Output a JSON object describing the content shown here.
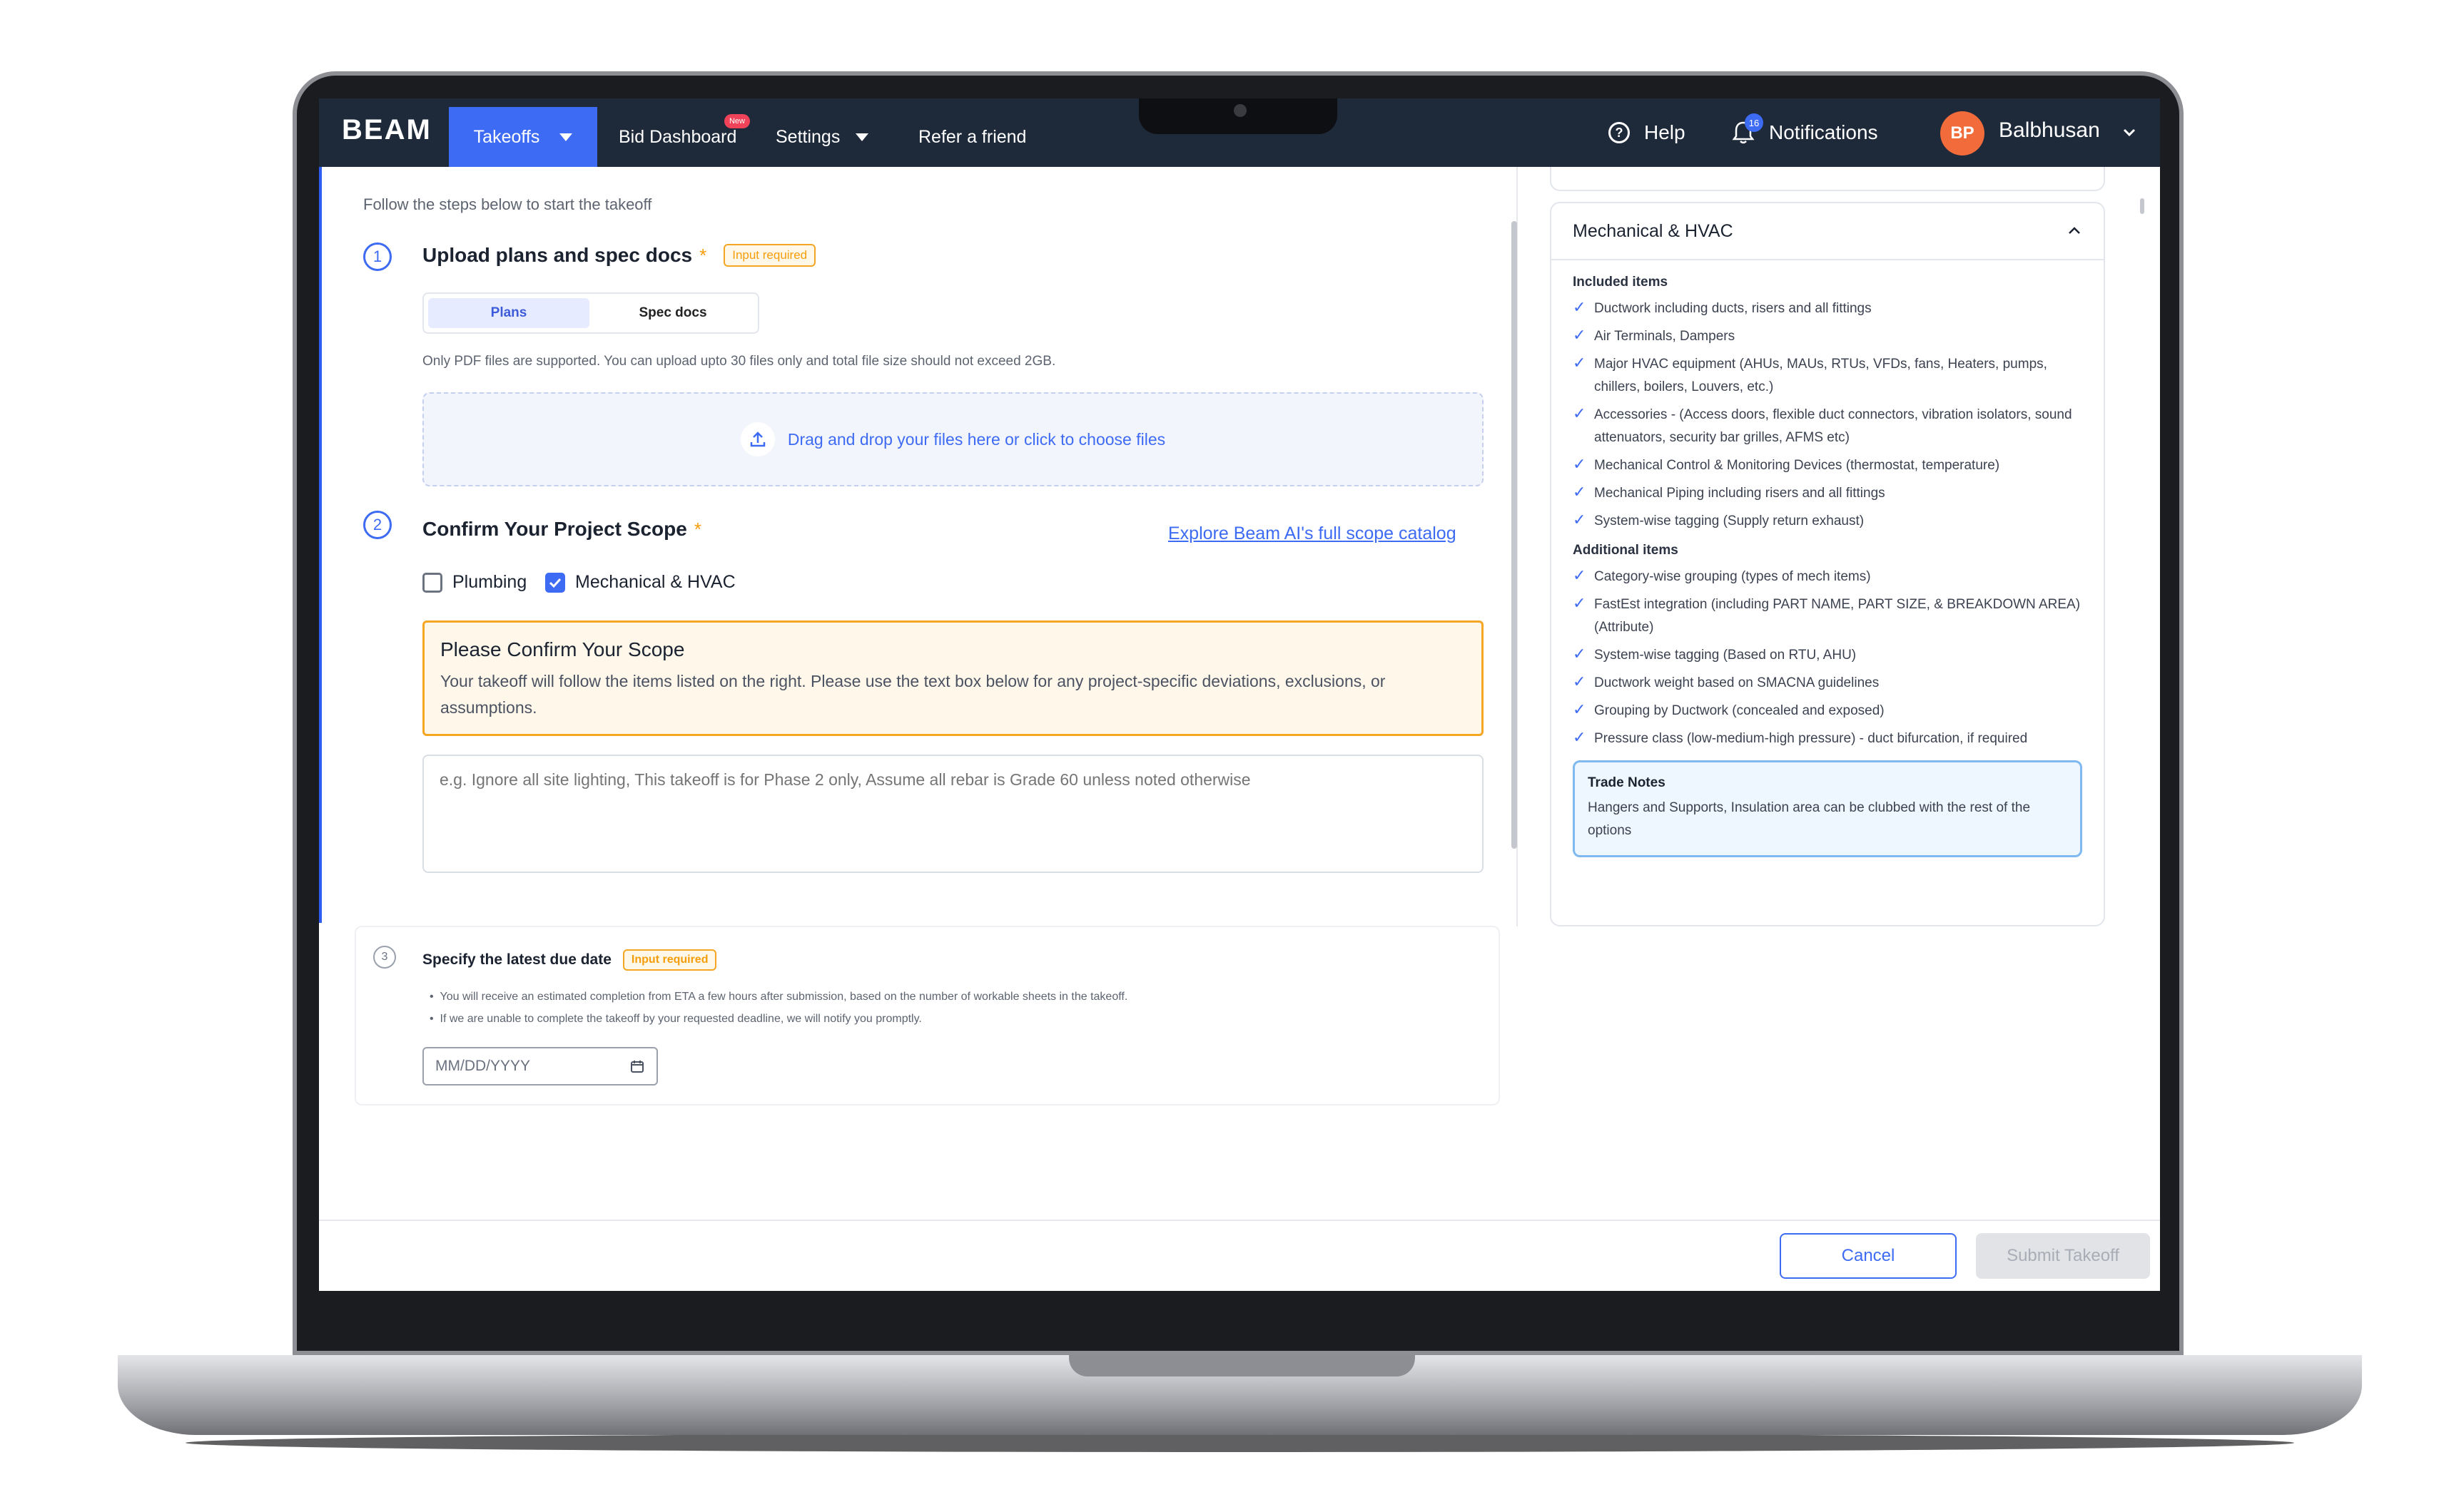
{
  "nav": {
    "logo": "BEAM",
    "takeoffs": "Takeoffs",
    "bid_dashboard": "Bid Dashboard",
    "new_badge": "New",
    "settings": "Settings",
    "refer": "Refer a friend",
    "help": "Help",
    "notifications": "Notifications",
    "notification_count": "16",
    "avatar_initials": "BP",
    "user_name": "Balbhusan"
  },
  "main": {
    "intro": "Follow the steps below to start the takeoff",
    "step1": {
      "number": "1",
      "title": "Upload plans and spec docs",
      "required_star": "*",
      "badge": "Input required",
      "tabs": [
        "Plans",
        "Spec docs"
      ],
      "note": "Only PDF files are supported. You can upload upto 30 files only and total file size should not exceed 2GB.",
      "dropzone": "Drag and drop your files here or click to choose files"
    },
    "step2": {
      "number": "2",
      "title": "Confirm Your Project Scope",
      "required_star": "*",
      "link": "Explore Beam AI's full scope catalog",
      "checkbox_plumbing": "Plumbing",
      "checkbox_mech": "Mechanical & HVAC",
      "plumbing_checked": false,
      "mech_checked": true,
      "confirm_title": "Please Confirm Your Scope",
      "confirm_text": "Your takeoff will follow the items listed on the right. Please use the text box below for any project-specific deviations, exclusions, or assumptions.",
      "textarea_placeholder": "e.g. Ignore all site lighting, This takeoff is for Phase 2 only, Assume all rebar is Grade 60 unless noted otherwise"
    },
    "step3": {
      "number": "3",
      "title": "Specify the latest due date",
      "badge": "Input required",
      "bullet1": "You will receive an estimated completion from ETA a few hours after submission, based on the number of workable sheets in the takeoff.",
      "bullet2": "If we are unable to complete the takeoff by your requested deadline, we will notify you promptly.",
      "date_placeholder": "MM/DD/YYYY"
    }
  },
  "scope_panel": {
    "title": "Mechanical & HVAC",
    "included_title": "Included items",
    "included": [
      "Ductwork including ducts, risers and all fittings",
      "Air Terminals, Dampers",
      "Major HVAC equipment (AHUs, MAUs, RTUs, VFDs, fans, Heaters, pumps, chillers, boilers, Louvers, etc.)",
      "Accessories - (Access doors, flexible duct connectors, vibration isolators, sound attenuators, security bar grilles, AFMS etc)",
      "Mechanical Control & Monitoring Devices (thermostat, temperature)",
      "Mechanical Piping including risers and all fittings",
      "System-wise tagging (Supply return exhaust)"
    ],
    "additional_title": "Additional items",
    "additional": [
      "Category-wise grouping (types of mech items)",
      "FastEst integration (including PART NAME, PART SIZE, & BREAKDOWN AREA) (Attribute)",
      "System-wise tagging (Based on RTU, AHU)",
      "Ductwork weight based on SMACNA guidelines",
      "Grouping by Ductwork (concealed and exposed)",
      "Pressure class (low-medium-high pressure) - duct bifurcation, if required"
    ],
    "trade_notes_title": "Trade Notes",
    "trade_notes_text": "Hangers and Supports, Insulation area can be clubbed with the rest of the options"
  },
  "footer": {
    "cancel": "Cancel",
    "submit": "Submit Takeoff"
  },
  "colors": {
    "accent": "#3e6bf3",
    "navbar": "#1e2a3a",
    "warning": "#f5a623",
    "avatar": "#f26b3a"
  }
}
